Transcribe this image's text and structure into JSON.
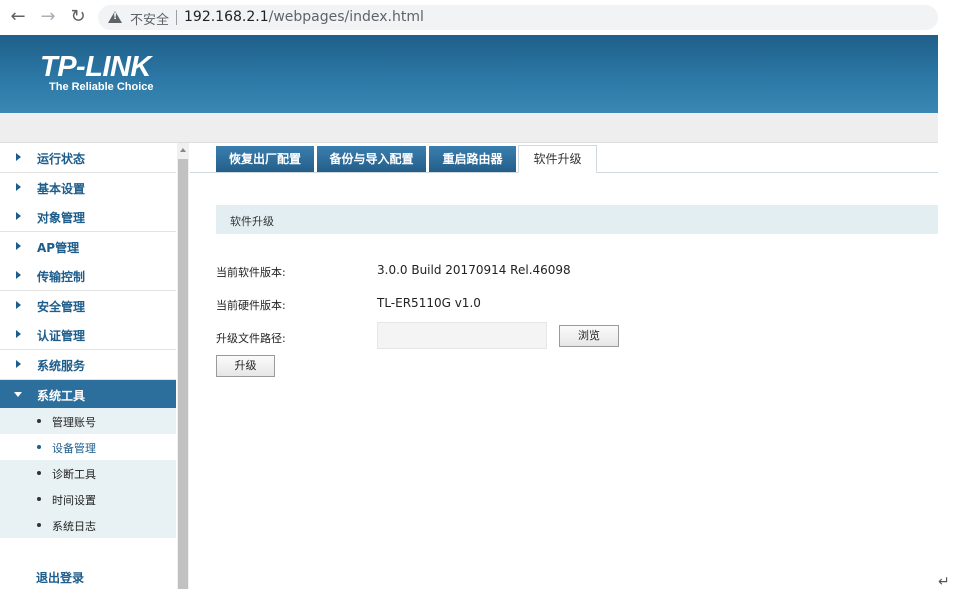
{
  "browser": {
    "back_icon": "←",
    "forward_icon": "→",
    "reload_icon": "↻",
    "security_label": "不安全",
    "url_host": "192.168.2.1",
    "url_path": "/webpages/index.html"
  },
  "header": {
    "brand": "TP-LINK",
    "tagline": "The Reliable Choice"
  },
  "sidebar": {
    "items": [
      {
        "label": "运行状态"
      },
      {
        "label": "基本设置"
      },
      {
        "label": "对象管理"
      },
      {
        "label": "AP管理"
      },
      {
        "label": "传输控制"
      },
      {
        "label": "安全管理"
      },
      {
        "label": "认证管理"
      },
      {
        "label": "系统服务"
      },
      {
        "label": "系统工具"
      }
    ],
    "subitems": [
      {
        "label": "管理账号"
      },
      {
        "label": "设备管理"
      },
      {
        "label": "诊断工具"
      },
      {
        "label": "时间设置"
      },
      {
        "label": "系统日志"
      }
    ],
    "logout": "退出登录"
  },
  "tabs": [
    {
      "label": "恢复出厂配置"
    },
    {
      "label": "备份与导入配置"
    },
    {
      "label": "重启路由器"
    },
    {
      "label": "软件升级"
    }
  ],
  "content": {
    "section_title": "软件升级",
    "software_version_label": "当前软件版本:",
    "software_version": "3.0.0 Build 20170914 Rel.46098",
    "hardware_version_label": "当前硬件版本:",
    "hardware_version": "TL-ER5110G v1.0",
    "upgrade_path_label": "升级文件路径:",
    "upgrade_path_value": "",
    "browse_button": "浏览",
    "upgrade_button": "升级"
  },
  "colors": {
    "brand_blue": "#2d6f9c",
    "link_blue": "#1d5d8c",
    "section_bg": "#e3eef3"
  }
}
